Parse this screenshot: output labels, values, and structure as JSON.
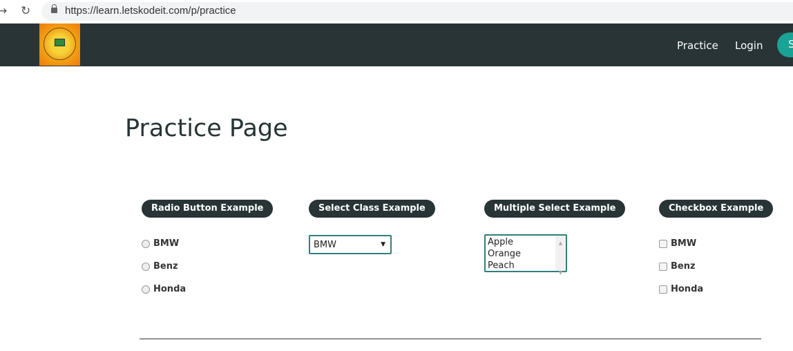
{
  "browser": {
    "url": "https://learn.letskodeit.com/p/practice"
  },
  "header": {
    "nav": [
      "Practice",
      "Login"
    ],
    "signup_label": "S",
    "logo_alt": "Let's Kode It"
  },
  "page": {
    "title": "Practice Page"
  },
  "radio": {
    "legend": "Radio Button Example",
    "options": [
      "BMW",
      "Benz",
      "Honda"
    ]
  },
  "select": {
    "legend": "Select Class Example",
    "value": "BMW"
  },
  "multi": {
    "legend": "Multiple Select Example",
    "options": [
      "Apple",
      "Orange",
      "Peach"
    ]
  },
  "checkbox": {
    "legend": "Checkbox Example",
    "options": [
      "BMW",
      "Benz",
      "Honda"
    ]
  },
  "colors": {
    "header": "#283436",
    "accent": "#1aa394",
    "border": "#2f7f7a"
  }
}
